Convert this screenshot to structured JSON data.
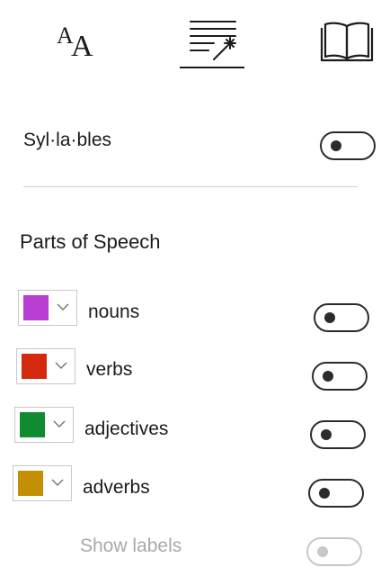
{
  "tabs": [
    {
      "icon": "text-preferences-icon",
      "selected": false
    },
    {
      "icon": "grammar-options-icon",
      "selected": true
    },
    {
      "icon": "reading-preferences-icon",
      "selected": false
    }
  ],
  "tab_glyph": {
    "small": "A",
    "big": "A"
  },
  "syllables": {
    "label": "Syl·la·bles",
    "on": false
  },
  "parts_of_speech": {
    "heading": "Parts of Speech",
    "items": [
      {
        "label": "nouns",
        "color": "#b83dd1",
        "on": false
      },
      {
        "label": "verbs",
        "color": "#d2290f",
        "on": false
      },
      {
        "label": "adjectives",
        "color": "#118b2f",
        "on": false
      },
      {
        "label": "adverbs",
        "color": "#c48e05",
        "on": false
      }
    ]
  },
  "show_labels": {
    "label": "Show labels",
    "on": false,
    "disabled": true
  },
  "colors": {
    "text": "#1b1b1b",
    "muted": "#a9a9a9",
    "divider": "#d0d0d0"
  }
}
